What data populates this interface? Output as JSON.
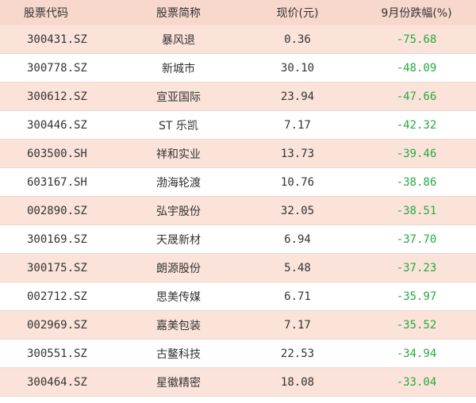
{
  "header": {
    "code": "股票代码",
    "name": "股票简称",
    "price": "现价(元)",
    "change": "9月份跌幅(%)"
  },
  "rows": [
    {
      "code": "300431.SZ",
      "name": "暴风退",
      "price": "0.36",
      "change": "-75.68"
    },
    {
      "code": "300778.SZ",
      "name": "新城市",
      "price": "30.10",
      "change": "-48.09"
    },
    {
      "code": "300612.SZ",
      "name": "宣亚国际",
      "price": "23.94",
      "change": "-47.66"
    },
    {
      "code": "300446.SZ",
      "name": "ST 乐凯",
      "price": "7.17",
      "change": "-42.32"
    },
    {
      "code": "603500.SH",
      "name": "祥和实业",
      "price": "13.73",
      "change": "-39.46"
    },
    {
      "code": "603167.SH",
      "name": "渤海轮渡",
      "price": "10.76",
      "change": "-38.86"
    },
    {
      "code": "002890.SZ",
      "name": "弘宇股份",
      "price": "32.05",
      "change": "-38.51"
    },
    {
      "code": "300169.SZ",
      "name": "天晟新材",
      "price": "6.94",
      "change": "-37.70"
    },
    {
      "code": "300175.SZ",
      "name": "朗源股份",
      "price": "5.48",
      "change": "-37.23"
    },
    {
      "code": "002712.SZ",
      "name": "思美传媒",
      "price": "6.71",
      "change": "-35.97"
    },
    {
      "code": "002969.SZ",
      "name": "嘉美包装",
      "price": "7.17",
      "change": "-35.52"
    },
    {
      "code": "300551.SZ",
      "name": "古鳌科技",
      "price": "22.53",
      "change": "-34.94"
    },
    {
      "code": "300464.SZ",
      "name": "星徽精密",
      "price": "18.08",
      "change": "-33.04"
    }
  ],
  "colors": {
    "header_bg": "#f8d8cc",
    "row_alt_bg": "#fbe3da",
    "change_text": "#27a844"
  }
}
